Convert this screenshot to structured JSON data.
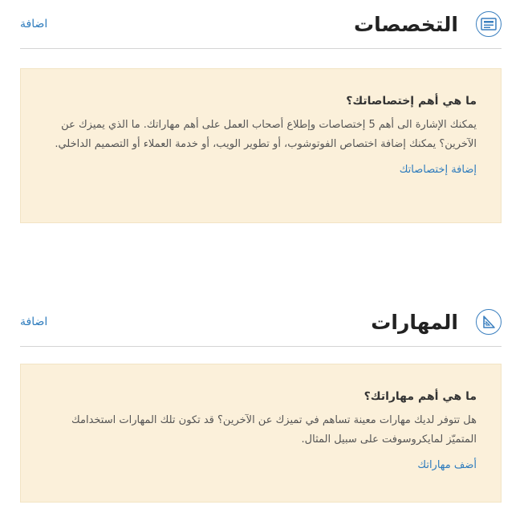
{
  "specializations": {
    "title": "التخصصات",
    "add_label": "اضافة",
    "icon": "list-card-icon",
    "box": {
      "heading": "ما هي أهم إختصاصاتك؟",
      "text": "يمكنك الإشارة الى أهم 5 إختصاصات وإطلاع أصحاب العمل على أهم مهاراتك. ما الذي يميزك عن الآخرين؟ يمكنك إضافة اختصاص الفوتوشوب، أو تطوير الويب، أو خدمة العملاء أو التصميم الداخلي.",
      "link": "إضافة إختصاصاتك"
    }
  },
  "skills": {
    "title": "المهارات",
    "add_label": "اضافة",
    "icon": "ruler-triangle-icon",
    "box": {
      "heading": "ما هي أهم مهاراتك؟",
      "text": "هل تتوفر لديك مهارات معينة تساهم في تميزك عن الآخرين؟ قد تكون تلك المهارات استخدامك المتميّز لمايكروسوفت على سبيل المثال.",
      "link": "أضف مهاراتك"
    }
  },
  "colors": {
    "accent": "#2d7bbd",
    "box_background": "#fbf0da",
    "divider": "#d4d4d4"
  }
}
